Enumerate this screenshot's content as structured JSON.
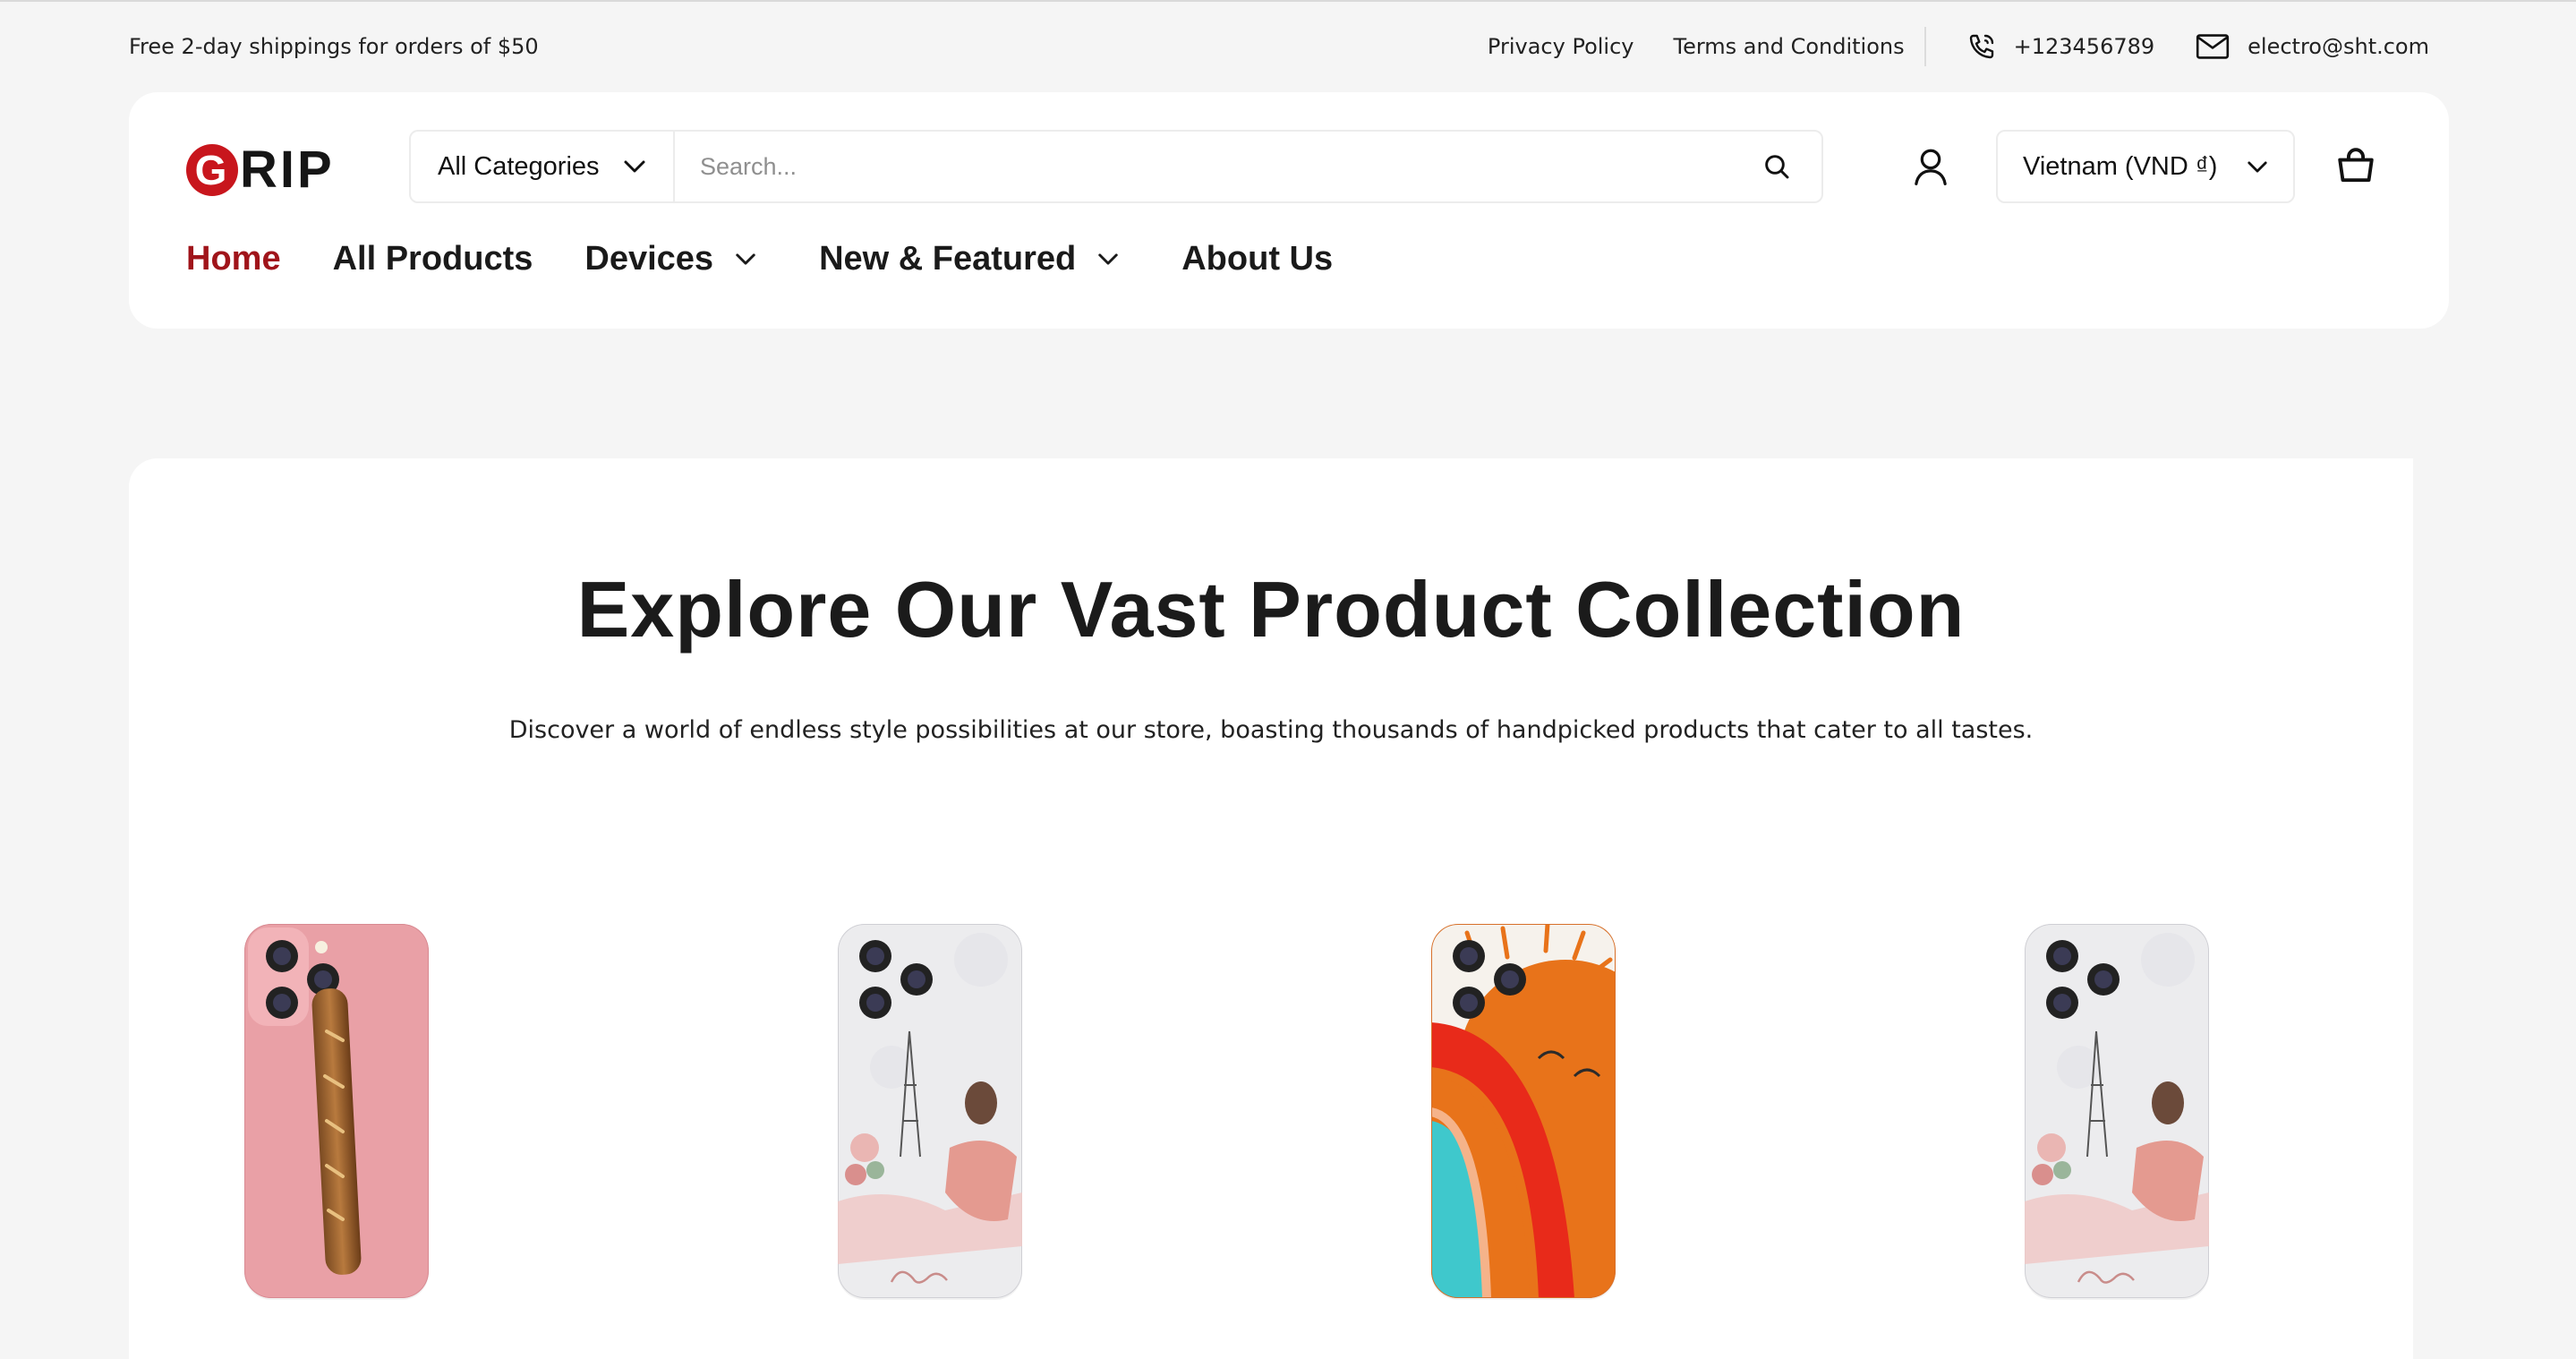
{
  "topbar": {
    "shipping_text": "Free 2-day shippings for orders of $50",
    "privacy_label": "Privacy Policy",
    "terms_label": "Terms and Conditions",
    "phone": "+123456789",
    "email": "electro@sht.com"
  },
  "header": {
    "logo_mark": "G",
    "logo_text": "RIP",
    "category_select": "All Categories",
    "search_placeholder": "Search...",
    "currency": "Vietnam (VND ₫)"
  },
  "nav": {
    "items": [
      {
        "label": "Home",
        "active": true
      },
      {
        "label": "All Products"
      },
      {
        "label": "Devices",
        "dropdown": true
      },
      {
        "label": "New & Featured",
        "dropdown": true
      },
      {
        "label": "About Us"
      }
    ]
  },
  "main": {
    "title": "Explore Our Vast Product Collection",
    "subtitle": "Discover a world of endless style possibilities at our store, boasting thousands of handpicked products that cater to all tastes."
  },
  "products": [
    {
      "design": "baguette-pink"
    },
    {
      "design": "paris-girl"
    },
    {
      "design": "orange-rainbow"
    },
    {
      "design": "paris-girl"
    }
  ],
  "colors": {
    "accent": "#a0141a",
    "logo_red": "#c8161d",
    "background": "#f5f5f5"
  }
}
